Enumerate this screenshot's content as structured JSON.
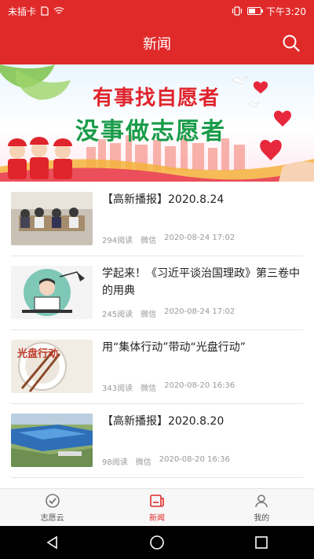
{
  "status_bar": {
    "carrier": "未插卡",
    "time": "下午3:20",
    "battery_level": 0.6
  },
  "header": {
    "title": "新闻",
    "search_icon": "search-icon"
  },
  "banner": {
    "line1": "有事找自愿者",
    "line2": "没事做志愿者"
  },
  "news": [
    {
      "title": "【高新播报】2020.8.24",
      "reads": "294阅读",
      "source": "微信",
      "date": "2020-08-24 17:02"
    },
    {
      "title": "学起来！《习近平谈治国理政》第三卷中的用典",
      "reads": "245阅读",
      "source": "微信",
      "date": "2020-08-24 17:02"
    },
    {
      "title": "用“集体行动”带动“光盘行动”",
      "reads": "343阅读",
      "source": "微信",
      "date": "2020-08-20 16:36",
      "thumb_text": "光盘行动"
    },
    {
      "title": "【高新播报】2020.8.20",
      "reads": "98阅读",
      "source": "微信",
      "date": "2020-08-20 16:36"
    }
  ],
  "bottom_nav": [
    {
      "label": "志愿云",
      "icon": "shield-check-icon"
    },
    {
      "label": "新闻",
      "icon": "news-icon",
      "active": true
    },
    {
      "label": "我的",
      "icon": "user-icon"
    }
  ],
  "colors": {
    "brand": "#e02a2a"
  }
}
